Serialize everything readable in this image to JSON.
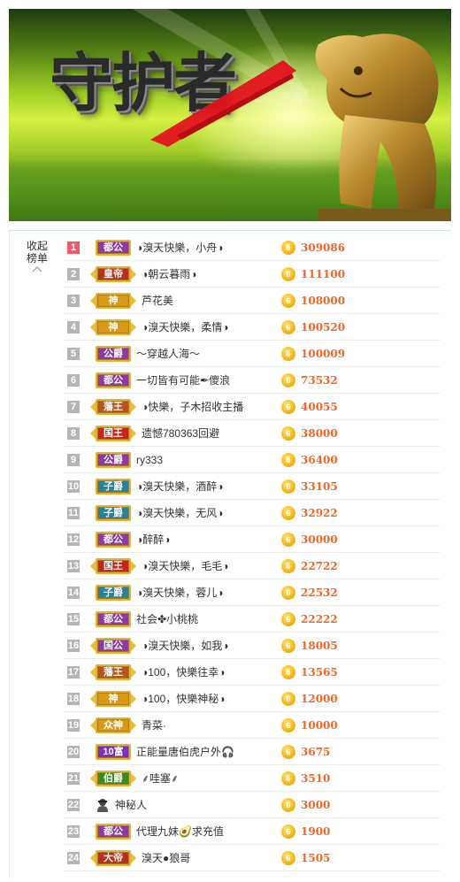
{
  "banner": {
    "title": "守护者",
    "scene": "lion-statue-banner"
  },
  "panel": {
    "collapse_label_line1": "收起",
    "collapse_label_line2": "榜单"
  },
  "colors": {
    "score": "#f26522",
    "rank_first": "#ef5a6a",
    "rank_default": "#b5b5b5",
    "coin": "#f2b614"
  },
  "rows": [
    {
      "rank": "1",
      "title": "都公",
      "title_color": "#8b3aa6",
      "name": "◑溴天快樂，小舟◑",
      "score": "309086"
    },
    {
      "rank": "2",
      "title": "皇帝",
      "title_color": "#b5321f",
      "name": "◑朝云暮雨◑",
      "score": "111100"
    },
    {
      "rank": "3",
      "title": "神",
      "title_color": "#d89a16",
      "name": "芦花美",
      "score": "108000"
    },
    {
      "rank": "4",
      "title": "神",
      "title_color": "#d89a16",
      "name": "◑溴天快樂，柔情◑",
      "score": "100520"
    },
    {
      "rank": "5",
      "title": "公爵",
      "title_color": "#8b3aa6",
      "name": "～穿越人海～",
      "score": "100009"
    },
    {
      "rank": "6",
      "title": "都公",
      "title_color": "#8b3aa6",
      "name": "一切皆有可能✒傻浪",
      "score": "73532"
    },
    {
      "rank": "7",
      "title": "藩王",
      "title_color": "#b5551f",
      "name": "◑快樂，子木招收主播",
      "score": "40055"
    },
    {
      "rank": "8",
      "title": "国王",
      "title_color": "#c2261c",
      "name": "遗憾780363回避",
      "score": "38000"
    },
    {
      "rank": "9",
      "title": "公爵",
      "title_color": "#8b3aa6",
      "name": "ry333",
      "score": "36400"
    },
    {
      "rank": "10",
      "title": "子爵",
      "title_color": "#2a7f9a",
      "name": "◑溴天快樂，酒醉◑",
      "score": "33105"
    },
    {
      "rank": "11",
      "title": "子爵",
      "title_color": "#2a7f9a",
      "name": "◑溴天快樂，无风◑",
      "score": "32922"
    },
    {
      "rank": "12",
      "title": "都公",
      "title_color": "#8b3aa6",
      "name": "◑醉醉◑",
      "score": "30000"
    },
    {
      "rank": "13",
      "title": "国王",
      "title_color": "#c2261c",
      "name": "◑溴天快樂，毛毛◑",
      "score": "22722"
    },
    {
      "rank": "14",
      "title": "子爵",
      "title_color": "#2a7f9a",
      "name": "◑溴天快樂，蓉儿◑",
      "score": "22532"
    },
    {
      "rank": "15",
      "title": "都公",
      "title_color": "#8b3aa6",
      "name": "社会✤小桃桃",
      "score": "22222"
    },
    {
      "rank": "16",
      "title": "国公",
      "title_color": "#8b3aa6",
      "name": "◑溴天快樂，如我◑",
      "score": "18005"
    },
    {
      "rank": "17",
      "title": "藩王",
      "title_color": "#b5551f",
      "name": "◑100，快樂往幸◑",
      "score": "13565"
    },
    {
      "rank": "18",
      "title": "神",
      "title_color": "#d89a16",
      "name": "◑100，快樂神秘◑",
      "score": "12000"
    },
    {
      "rank": "19",
      "title": "众神",
      "title_color": "#d89a16",
      "name": "青菜·",
      "score": "10000"
    },
    {
      "rank": "20",
      "title": "10富",
      "title_color": "#7a2fc0",
      "name": "正能量唐伯虎户外🎧",
      "score": "3675"
    },
    {
      "rank": "21",
      "title": "伯爵",
      "title_color": "#3a8a2a",
      "name": "⸙哇塞⸙",
      "score": "3510"
    },
    {
      "rank": "22",
      "title": "",
      "title_color": "",
      "name": "神秘人",
      "score": "3000",
      "mystery": true
    },
    {
      "rank": "23",
      "title": "都公",
      "title_color": "#8b3aa6",
      "name": "代理九妹🥑求充值",
      "score": "1900"
    },
    {
      "rank": "24",
      "title": "大帝",
      "title_color": "#b5321f",
      "name": "溴天●狼哥",
      "score": "1505"
    }
  ]
}
